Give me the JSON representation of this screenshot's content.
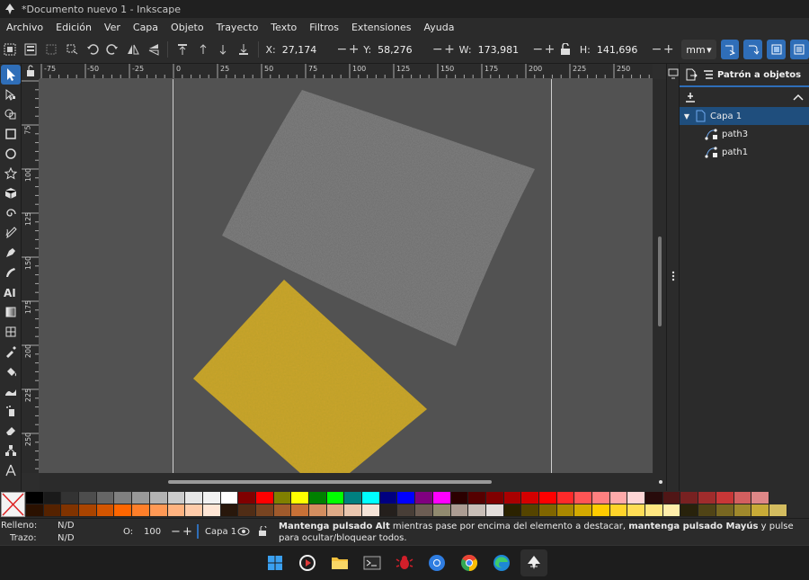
{
  "window": {
    "title": "*Documento nuevo 1 - Inkscape"
  },
  "menu": [
    "Archivo",
    "Edición",
    "Ver",
    "Capa",
    "Objeto",
    "Trayecto",
    "Texto",
    "Filtros",
    "Extensiones",
    "Ayuda"
  ],
  "toolbar": {
    "x_label": "X:",
    "x_value": "27,174",
    "y_label": "Y:",
    "y_value": "58,276",
    "w_label": "W:",
    "w_value": "173,981",
    "h_label": "H:",
    "h_value": "141,696",
    "minus": "−",
    "plus": "+",
    "unit": "mm"
  },
  "ruler": {
    "top": [
      "-75",
      "-50",
      "-25",
      "0",
      "25",
      "50",
      "75",
      "100",
      "125",
      "150",
      "175",
      "200",
      "225",
      "250"
    ],
    "left": [
      "75",
      "100",
      "125",
      "150",
      "175",
      "200",
      "225",
      "250"
    ]
  },
  "panel": {
    "tab_label": "Patrón a objetos",
    "layer_name": "Capa 1",
    "objects": [
      "path3",
      "path1"
    ]
  },
  "palette": {
    "row1": [
      "#000000",
      "#1a1a1a",
      "#333333",
      "#4d4d4d",
      "#666666",
      "#808080",
      "#999999",
      "#b3b3b3",
      "#cccccc",
      "#e6e6e6",
      "#f2f2f2",
      "#ffffff",
      "#800000",
      "#ff0000",
      "#808000",
      "#ffff00",
      "#008000",
      "#00ff00",
      "#008080",
      "#00ffff",
      "#000080",
      "#0000ff",
      "#800080",
      "#ff00ff",
      "#2b0000",
      "#550000",
      "#800000",
      "#aa0000",
      "#d40000",
      "#ff0000",
      "#ff2a2a",
      "#ff5555",
      "#ff8080",
      "#ffaaaa",
      "#ffd5d5",
      "#280b0b",
      "#501616",
      "#782121",
      "#a02c2c",
      "#c83737",
      "#d35f5f",
      "#de8787"
    ],
    "row2": [
      "#2b1100",
      "#552200",
      "#803300",
      "#aa4400",
      "#d45500",
      "#ff6600",
      "#ff7f2a",
      "#ff9955",
      "#ffb380",
      "#ffccaa",
      "#ffe6d5",
      "#28170b",
      "#502d16",
      "#784421",
      "#a05a2c",
      "#c87137",
      "#d38d5f",
      "#deaa87",
      "#e9c6af",
      "#f4e3d7",
      "#241f1c",
      "#483e37",
      "#6c5d53",
      "#918a6f",
      "#ac9d93",
      "#c8beb7",
      "#e3dedb",
      "#2b2200",
      "#554400",
      "#806600",
      "#aa8800",
      "#d4aa00",
      "#ffcc00",
      "#ffd42a",
      "#ffdd55",
      "#ffe680",
      "#ffeeaa",
      "#28220b",
      "#504416",
      "#786721",
      "#a0892c",
      "#c8ab37",
      "#d3bc5f"
    ]
  },
  "status": {
    "fill_label": "Relleno:",
    "fill_value": "N/D",
    "stroke_label": "Trazo:",
    "stroke_value": "N/D",
    "opacity_label": "O:",
    "opacity_value": "100",
    "layer": "Capa 1",
    "msg_b1": "Mantenga pulsado Alt",
    "msg_t1": " mientras pase por encima del elemento a destacar, ",
    "msg_b2": "mantenga pulsado Mayús",
    "msg_t2": " y pulse para ocultar/bloquear todos."
  },
  "colors": {
    "accent": "#2f6eb8",
    "canvas": "#525252",
    "selection": "#1f4e7d",
    "texture_yellow": "#c9a52a",
    "texture_gray": "#6a6a6a"
  }
}
